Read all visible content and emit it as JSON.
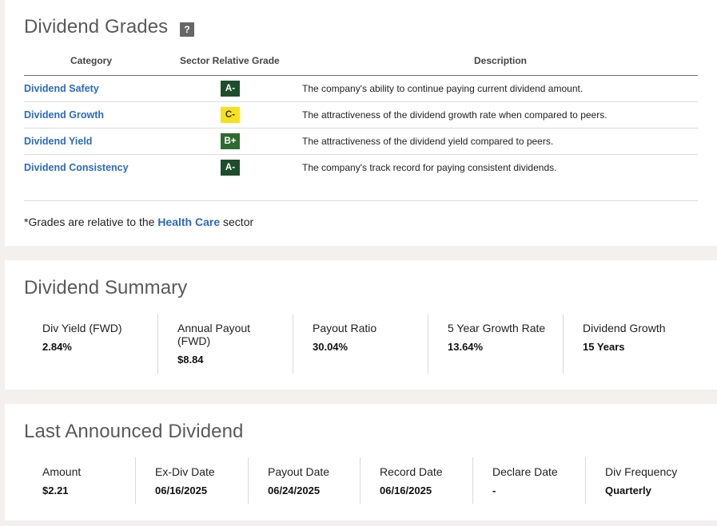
{
  "grades": {
    "title": "Dividend Grades",
    "help_label": "?",
    "columns": {
      "category": "Category",
      "grade": "Sector Relative Grade",
      "description": "Description"
    },
    "rows": [
      {
        "category": "Dividend Safety",
        "grade": "A-",
        "grade_bg": "#1e4d2b",
        "grade_fg": "#ffffff",
        "description": "The company's ability to continue paying current dividend amount."
      },
      {
        "category": "Dividend Growth",
        "grade": "C-",
        "grade_bg": "#f5e21a",
        "grade_fg": "#333333",
        "description": "The attractiveness of the dividend growth rate when compared to peers."
      },
      {
        "category": "Dividend Yield",
        "grade": "B+",
        "grade_bg": "#2e6b2e",
        "grade_fg": "#ffffff",
        "description": "The attractiveness of the dividend yield compared to peers."
      },
      {
        "category": "Dividend Consistency",
        "grade": "A-",
        "grade_bg": "#1e4d2b",
        "grade_fg": "#ffffff",
        "description": "The company's track record for paying consistent dividends."
      }
    ],
    "footnote_prefix": "*Grades are relative to the ",
    "footnote_sector": "Health Care",
    "footnote_suffix": " sector"
  },
  "summary": {
    "title": "Dividend Summary",
    "stats": [
      {
        "label": "Div Yield (FWD)",
        "value": "2.84%"
      },
      {
        "label": "Annual Payout (FWD)",
        "value": "$8.84"
      },
      {
        "label": "Payout Ratio",
        "value": "30.04%"
      },
      {
        "label": "5 Year Growth Rate",
        "value": "13.64%"
      },
      {
        "label": "Dividend Growth",
        "value": "15 Years"
      }
    ]
  },
  "last_dividend": {
    "title": "Last Announced Dividend",
    "stats": [
      {
        "label": "Amount",
        "value": "$2.21"
      },
      {
        "label": "Ex-Div Date",
        "value": "06/16/2025"
      },
      {
        "label": "Payout Date",
        "value": "06/24/2025"
      },
      {
        "label": "Record Date",
        "value": "06/16/2025"
      },
      {
        "label": "Declare Date",
        "value": "-"
      },
      {
        "label": "Div Frequency",
        "value": "Quarterly"
      }
    ]
  },
  "colors": {
    "link": "#2a6bc1",
    "page_bg": "#f3f0ee"
  }
}
